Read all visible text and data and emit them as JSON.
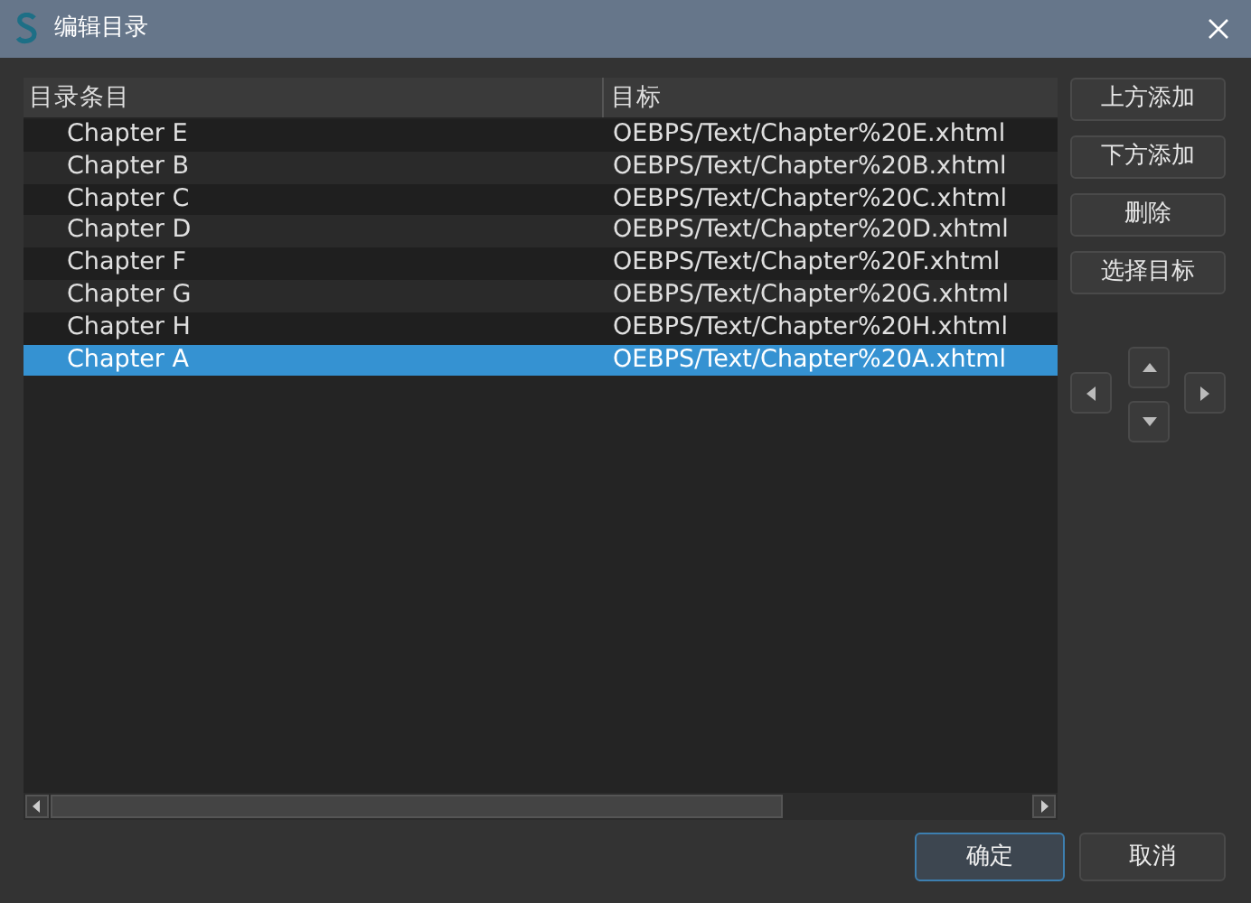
{
  "window": {
    "title": "编辑目录"
  },
  "table": {
    "columns": [
      "目录条目",
      "目标"
    ],
    "rows": [
      {
        "entry": "Chapter E",
        "target": "OEBPS/Text/Chapter%20E.xhtml",
        "selected": false
      },
      {
        "entry": "Chapter B",
        "target": "OEBPS/Text/Chapter%20B.xhtml",
        "selected": false
      },
      {
        "entry": "Chapter C",
        "target": "OEBPS/Text/Chapter%20C.xhtml",
        "selected": false
      },
      {
        "entry": "Chapter D",
        "target": "OEBPS/Text/Chapter%20D.xhtml",
        "selected": false
      },
      {
        "entry": "Chapter F",
        "target": "OEBPS/Text/Chapter%20F.xhtml",
        "selected": false
      },
      {
        "entry": "Chapter G",
        "target": "OEBPS/Text/Chapter%20G.xhtml",
        "selected": false
      },
      {
        "entry": "Chapter H",
        "target": "OEBPS/Text/Chapter%20H.xhtml",
        "selected": false
      },
      {
        "entry": "Chapter A",
        "target": "OEBPS/Text/Chapter%20A.xhtml",
        "selected": true
      }
    ]
  },
  "side_buttons": [
    "上方添加",
    "下方添加",
    "删除",
    "选择目标"
  ],
  "dialog_buttons": [
    {
      "label": "确定",
      "default": true
    },
    {
      "label": "取消",
      "default": false
    }
  ]
}
